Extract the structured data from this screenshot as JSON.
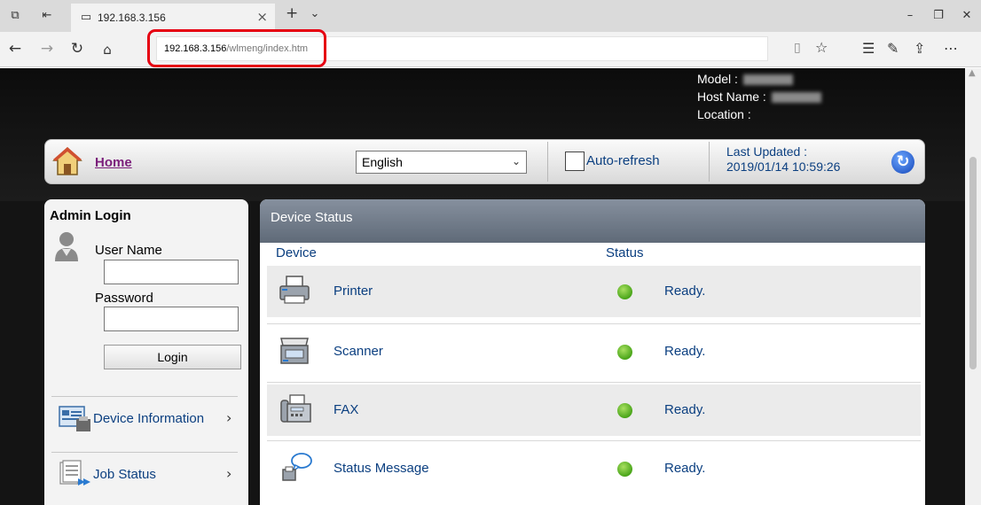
{
  "browser": {
    "tab_title": "192.168.3.156",
    "url_host": "192.168.3.156",
    "url_path": "/wlmeng/index.htm"
  },
  "device_info": {
    "model_label": "Model :",
    "host_label": "Host Name :",
    "location_label": "Location :"
  },
  "topbar": {
    "home_label": "Home",
    "language": "English",
    "auto_refresh_label": "Auto-refresh",
    "last_updated_label": "Last Updated :",
    "last_updated_value": "2019/01/14 10:59:26"
  },
  "login": {
    "title": "Admin Login",
    "username_label": "User Name",
    "password_label": "Password",
    "login_button": "Login"
  },
  "menu": [
    {
      "label": "Device Information",
      "icon": "device-information-icon"
    },
    {
      "label": "Job Status",
      "icon": "job-status-icon"
    }
  ],
  "status": {
    "title": "Device Status",
    "col_device": "Device",
    "col_status": "Status",
    "rows": [
      {
        "device": "Printer",
        "status": "Ready.",
        "icon": "printer-icon"
      },
      {
        "device": "Scanner",
        "status": "Ready.",
        "icon": "scanner-icon"
      },
      {
        "device": "FAX",
        "status": "Ready.",
        "icon": "fax-icon"
      },
      {
        "device": "Status Message",
        "status": "Ready.",
        "icon": "status-message-icon"
      }
    ]
  },
  "colors": {
    "highlight": "#e60012",
    "link": "#0b3f80",
    "ready": "#4aa51a"
  }
}
